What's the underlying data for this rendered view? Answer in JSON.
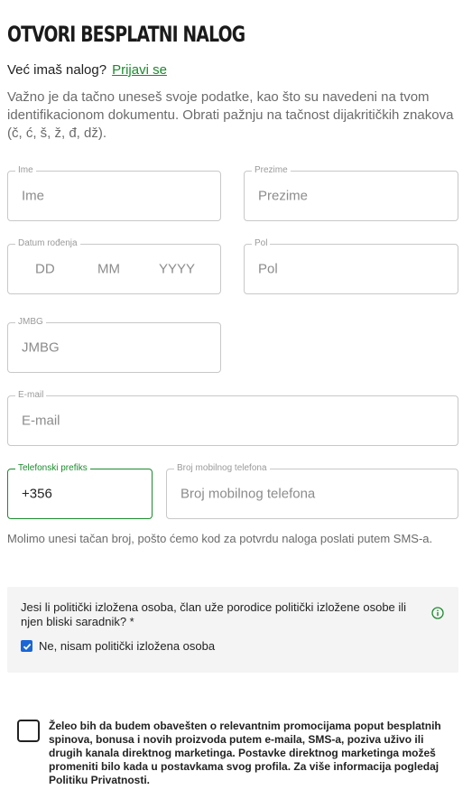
{
  "header": {
    "title": "OTVORI BESPLATNI NALOG",
    "have_account": "Već imaš nalog?",
    "login_link": "Prijavi se"
  },
  "intro": "Važno je da tačno uneseš svoje podatke, kao što su navedeni na tvom identifikacionom dokumentu. Obrati pažnju na tačnost dijakritičkih znakova (č, ć, š, ž, đ, dž).",
  "form": {
    "first_name": {
      "label": "Ime",
      "placeholder": "Ime"
    },
    "last_name": {
      "label": "Prezime",
      "placeholder": "Prezime"
    },
    "dob": {
      "label": "Datum rođenja",
      "day": "DD",
      "month": "MM",
      "year": "YYYY"
    },
    "gender": {
      "label": "Pol",
      "placeholder": "Pol"
    },
    "jmbg": {
      "label": "JMBG",
      "placeholder": "JMBG"
    },
    "email": {
      "label": "E-mail",
      "placeholder": "E-mail"
    },
    "phone_prefix": {
      "label": "Telefonski prefiks",
      "value": "+356"
    },
    "phone_number": {
      "label": "Broj mobilnog telefona",
      "placeholder": "Broj mobilnog telefona"
    },
    "phone_hint": "Molimo unesi tačan broj, pošto ćemo kod za potvrdu naloga poslati putem SMS-a."
  },
  "pep": {
    "question": "Jesi li politički izložena osoba, član uže porodice politički izložene osobe ili njen bliski saradnik? *",
    "option_label": "Ne, nisam politički izložena osoba",
    "option_checked": true
  },
  "promo": {
    "text": "Želeo bih da budem obavešten o relevantnim promocijama poput besplatnih spinova, bonusa i novih proizvoda putem e-maila, SMS-a, poziva uživo ili drugih kanala direktnog marketinga. Postavke direktnog marketinga možeš promeniti bilo kada u postavkama svog profila. Za više informacija pogledaj Politiku Privatnosti.",
    "checked": false
  },
  "colors": {
    "accent": "#1c8a2e",
    "checkbox": "#1a66d6"
  }
}
